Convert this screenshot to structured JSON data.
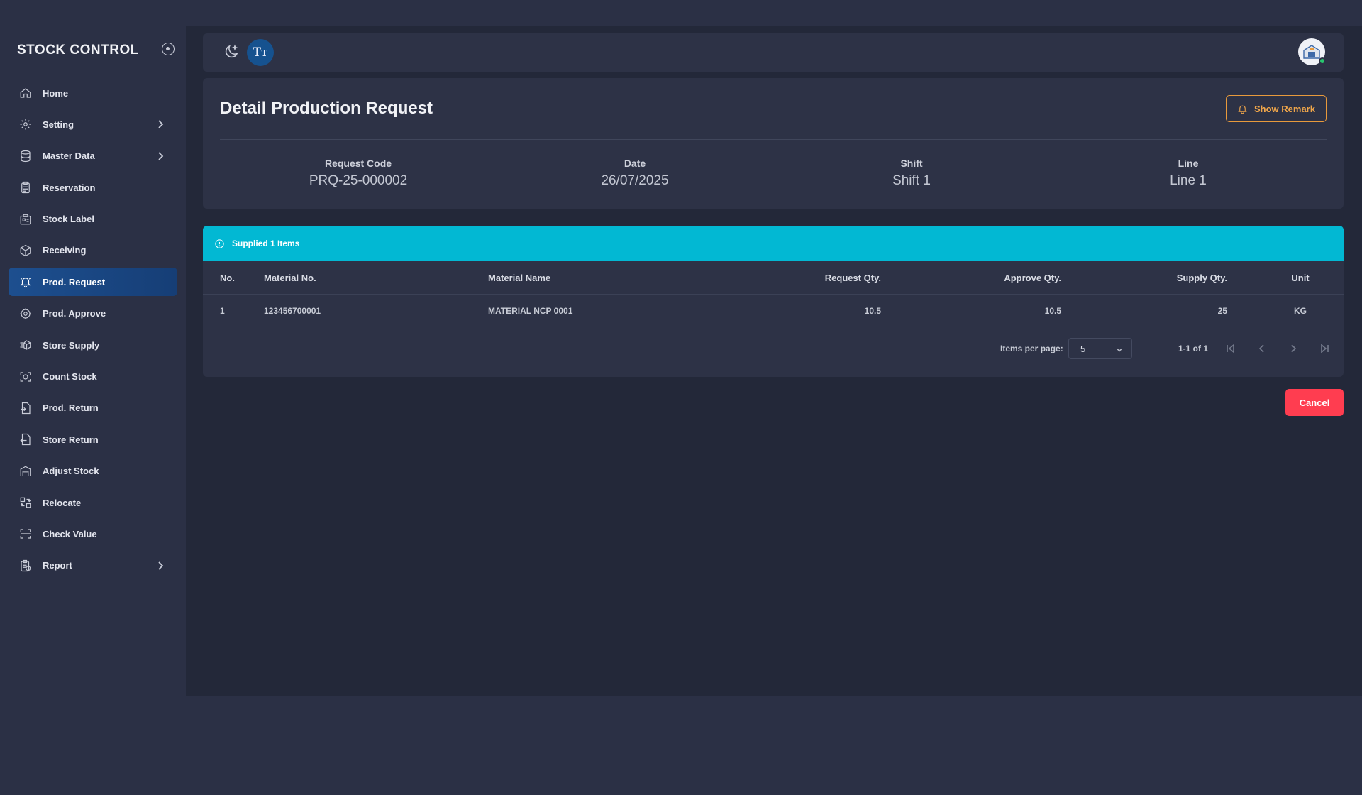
{
  "sidebar": {
    "brand": "STOCK CONTROL",
    "items": [
      {
        "label": "Home",
        "icon": "home-icon",
        "chevron": false,
        "active": false
      },
      {
        "label": "Setting",
        "icon": "gear-icon",
        "chevron": true,
        "active": false
      },
      {
        "label": "Master Data",
        "icon": "database-icon",
        "chevron": true,
        "active": false
      },
      {
        "label": "Reservation",
        "icon": "clipboard-icon",
        "chevron": false,
        "active": false
      },
      {
        "label": "Stock Label",
        "icon": "label-icon",
        "chevron": false,
        "active": false
      },
      {
        "label": "Receiving",
        "icon": "package-icon",
        "chevron": false,
        "active": false
      },
      {
        "label": "Prod. Request",
        "icon": "bell-icon",
        "chevron": false,
        "active": true
      },
      {
        "label": "Prod. Approve",
        "icon": "gear-check-icon",
        "chevron": false,
        "active": false
      },
      {
        "label": "Store Supply",
        "icon": "supply-icon",
        "chevron": false,
        "active": false
      },
      {
        "label": "Count Stock",
        "icon": "scan-icon",
        "chevron": false,
        "active": false
      },
      {
        "label": "Prod. Return",
        "icon": "return-in-icon",
        "chevron": false,
        "active": false
      },
      {
        "label": "Store Return",
        "icon": "return-out-icon",
        "chevron": false,
        "active": false
      },
      {
        "label": "Adjust Stock",
        "icon": "warehouse-icon",
        "chevron": false,
        "active": false
      },
      {
        "label": "Relocate",
        "icon": "relocate-icon",
        "chevron": false,
        "active": false
      },
      {
        "label": "Check Value",
        "icon": "frame-icon",
        "chevron": false,
        "active": false
      },
      {
        "label": "Report",
        "icon": "report-icon",
        "chevron": true,
        "active": false
      }
    ]
  },
  "topbar": {
    "theme_icon": "moon-icon",
    "font_button": "Tт"
  },
  "header": {
    "title": "Detail Production Request",
    "remark_button": "Show Remark",
    "info": [
      {
        "label": "Request Code",
        "value": "PRQ-25-000002"
      },
      {
        "label": "Date",
        "value": "26/07/2025"
      },
      {
        "label": "Shift",
        "value": "Shift 1"
      },
      {
        "label": "Line",
        "value": "Line 1"
      }
    ]
  },
  "table": {
    "alert": "Supplied 1 Items",
    "columns": [
      "No.",
      "Material No.",
      "Material Name",
      "Request Qty.",
      "Approve Qty.",
      "Supply Qty.",
      "Unit"
    ],
    "rows": [
      {
        "no": "1",
        "material_no": "123456700001",
        "material_name": "MATERIAL NCP 0001",
        "request_qty": "10.5",
        "approve_qty": "10.5",
        "supply_qty": "25",
        "unit": "KG"
      }
    ]
  },
  "pagination": {
    "items_per_page_label": "Items per page:",
    "items_per_page": "5",
    "range": "1-1 of 1"
  },
  "actions": {
    "cancel": "Cancel"
  },
  "colors": {
    "accent": "#02b8d3",
    "active_nav": "#1d4f8f",
    "remark": "#e89a3c",
    "cancel": "#ff3d50"
  }
}
